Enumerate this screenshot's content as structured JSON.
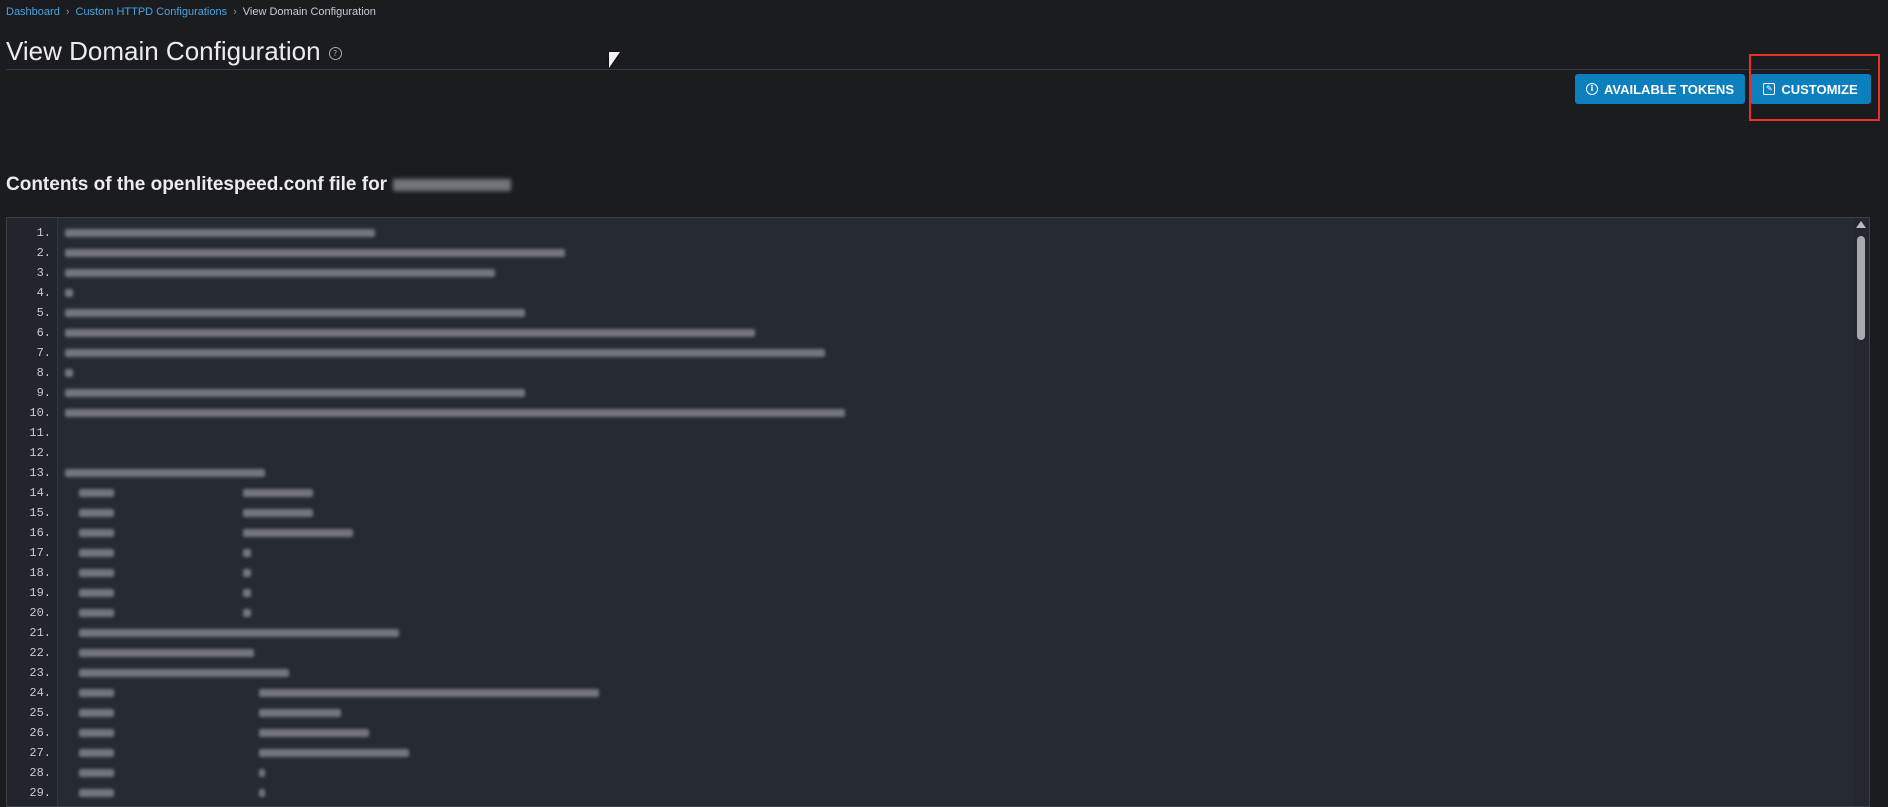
{
  "breadcrumb": {
    "items": [
      "Dashboard",
      "Custom HTTPD Configurations",
      "View Domain Configuration"
    ],
    "separator": "›"
  },
  "header": {
    "title": "View Domain Configuration",
    "help_icon": "help-circle-icon"
  },
  "toolbar": {
    "available_tokens_label": "AVAILABLE TOKENS",
    "available_tokens_icon": "info-icon",
    "customize_label": "CUSTOMIZE",
    "customize_icon": "edit-icon"
  },
  "content": {
    "heading": "Contents of the openlitespeed.conf file for",
    "domain_redacted": true
  },
  "editor": {
    "line_numbers": [
      "1.",
      "2.",
      "3.",
      "4.",
      "5.",
      "6.",
      "7.",
      "8.",
      "9.",
      "10.",
      "11.",
      "12.",
      "13.",
      "14.",
      "15.",
      "16.",
      "17.",
      "18.",
      "19.",
      "20.",
      "21.",
      "22.",
      "23.",
      "24.",
      "25.",
      "26.",
      "27.",
      "28.",
      "29."
    ],
    "content_redacted": true
  },
  "colors": {
    "background": "#1b1c1f",
    "editor_bg": "#262a31",
    "accent": "#0c7fbf",
    "link": "#4aa3df",
    "highlight": "#e8302b"
  }
}
